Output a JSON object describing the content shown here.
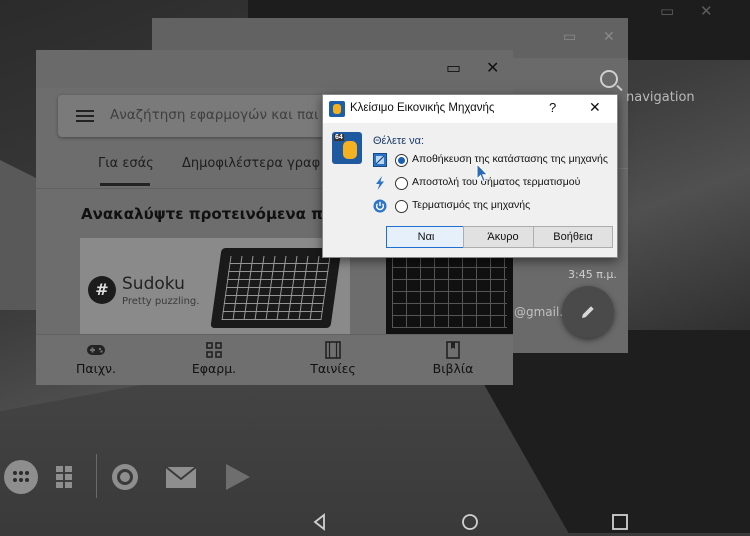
{
  "back_window": {
    "nav_text": "navigation",
    "time1": "3:45 π.μ.",
    "email": "@gmail.com"
  },
  "play_store": {
    "search_placeholder": "Αναζήτηση εφαρμογών και παι",
    "tabs": [
      {
        "label": "Για εσάς",
        "active": true
      },
      {
        "label": "Δημοφιλέστερα γραφ",
        "active": false
      }
    ],
    "section_title": "Ανακαλύψτε προτεινόμενα παι",
    "card": {
      "logo": "#",
      "name": "Sudoku",
      "tagline": "Pretty puzzling."
    },
    "bottom_nav": [
      {
        "label": "Παιχν.",
        "icon": "gamepad-icon"
      },
      {
        "label": "Εφαρμ.",
        "icon": "apps-grid-icon"
      },
      {
        "label": "Ταινίες",
        "icon": "film-icon"
      },
      {
        "label": "Βιβλία",
        "icon": "book-icon"
      }
    ]
  },
  "dialog": {
    "title": "Κλείσιμο Εικονικής Μηχανής",
    "help": "?",
    "close": "✕",
    "badge": "64",
    "question": "Θέλετε να:",
    "options": [
      {
        "label": "Αποθήκευση της κατάστασης της μηχανής",
        "selected": true,
        "icon": "save-state-icon"
      },
      {
        "label": "Αποστολή του σήματος τερματισμού",
        "selected": false,
        "icon": "lightning-icon"
      },
      {
        "label": "Τερματισμός της μηχανής",
        "selected": false,
        "icon": "power-icon"
      }
    ],
    "buttons": {
      "ok": "Ναι",
      "cancel": "Άκυρο",
      "help": "Βοήθεια"
    }
  },
  "colors": {
    "accent": "#1b5fb5",
    "dialog_bg": "#f0f0f0"
  }
}
